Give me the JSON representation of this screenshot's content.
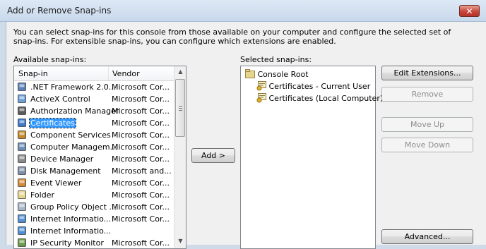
{
  "window": {
    "title": "Add or Remove Snap-ins",
    "close_label": "✕"
  },
  "description": "You can select snap-ins for this console from those available on your computer and configure the selected set of snap-ins. For extensible snap-ins, you can configure which extensions are enabled.",
  "available": {
    "label": "Available snap-ins:",
    "columns": {
      "name": "Snap-in",
      "vendor": "Vendor"
    },
    "items": [
      {
        "name": ".NET Framework 2.0...",
        "vendor": "Microsoft Cor...",
        "icon": "dotnet-config-icon"
      },
      {
        "name": "ActiveX Control",
        "vendor": "Microsoft Cor...",
        "icon": "activex-icon"
      },
      {
        "name": "Authorization Manager",
        "vendor": "Microsoft Cor...",
        "icon": "authorization-icon"
      },
      {
        "name": "Certificates",
        "vendor": "Microsoft Cor...",
        "icon": "certificates-icon",
        "selected": true
      },
      {
        "name": "Component Services",
        "vendor": "Microsoft Cor...",
        "icon": "component-services-icon"
      },
      {
        "name": "Computer Managem...",
        "vendor": "Microsoft Cor...",
        "icon": "computer-management-icon"
      },
      {
        "name": "Device Manager",
        "vendor": "Microsoft Cor...",
        "icon": "device-manager-icon"
      },
      {
        "name": "Disk Management",
        "vendor": "Microsoft and...",
        "icon": "disk-management-icon"
      },
      {
        "name": "Event Viewer",
        "vendor": "Microsoft Cor...",
        "icon": "event-viewer-icon"
      },
      {
        "name": "Folder",
        "vendor": "Microsoft Cor...",
        "icon": "folder-icon"
      },
      {
        "name": "Group Policy Object ...",
        "vendor": "Microsoft Cor...",
        "icon": "group-policy-icon"
      },
      {
        "name": "Internet Informatio...",
        "vendor": "Microsoft Cor...",
        "icon": "iis-icon"
      },
      {
        "name": "Internet Informatio...",
        "vendor": "",
        "icon": "iis-icon"
      },
      {
        "name": "IP Security Monitor",
        "vendor": "Microsoft Cor...",
        "icon": "ip-security-icon"
      }
    ]
  },
  "add_button": "Add >",
  "selected": {
    "label": "Selected snap-ins:",
    "root": "Console Root",
    "children": [
      "Certificates - Current User",
      "Certificates (Local Computer)"
    ]
  },
  "buttons": {
    "edit_extensions": "Edit Extensions...",
    "remove": "Remove",
    "move_up": "Move Up",
    "move_down": "Move Down",
    "advanced": "Advanced..."
  }
}
